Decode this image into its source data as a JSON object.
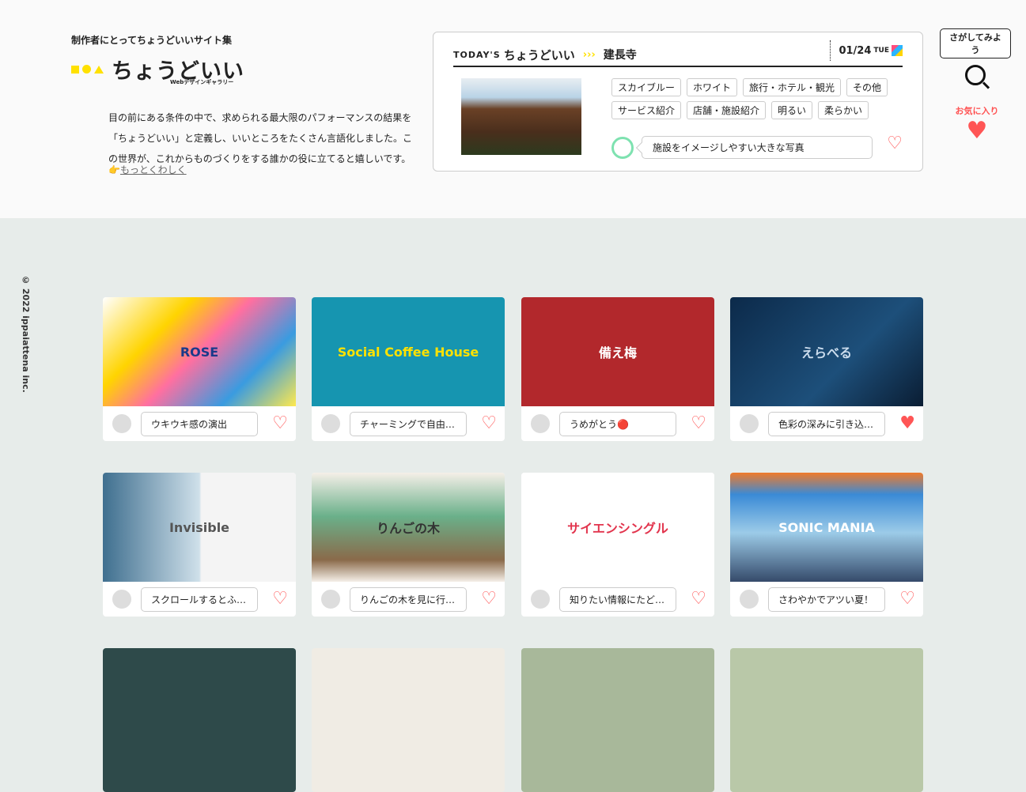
{
  "header": {
    "tagline": "制作者にとってちょうどいいサイト集",
    "logo": "ちょうどいい",
    "logo_sub": "Webデザインギャラリー",
    "description": "目の前にある条件の中で、求められる最大限のパフォーマンスの結果を「ちょうどいい」と定義し、いいところをたくさん言語化しました。この世界が、これからものづくりをする誰かの役に立てると嬉しいです。",
    "more_link": "もっとくわしく"
  },
  "today": {
    "label": "TODAY'S",
    "title": "ちょうどいい",
    "arrows": "›››",
    "site": "建長寺",
    "date": "01/24",
    "weekday": "TUE",
    "tags": [
      "スカイブルー",
      "ホワイト",
      "旅行・ホテル・観光",
      "その他",
      "サービス紹介",
      "店舗・施設紹介",
      "明るい",
      "柔らかい"
    ],
    "comment": "施設をイメージしやすい大きな写真"
  },
  "nav": {
    "search_tip": "さがしてみよう",
    "favorites": "お気に入り"
  },
  "copyright": "© 2022 ippaiattena inc.",
  "cards": [
    {
      "thumb_text": "ROSE",
      "comment": "ウキウキ感の演出",
      "favorited": false,
      "bg": "linear-gradient(135deg,#fff 0,#ffd400 30%,#ff6fa0 50%,#3a9be0 75%,#ffe94d 100%)",
      "fg": "#1a3a8a"
    },
    {
      "thumb_text": "Social Coffee House",
      "comment": "チャーミングで自由な雰囲気",
      "favorited": false,
      "bg": "#1695b0",
      "fg": "#ffe100"
    },
    {
      "thumb_text": "備え梅",
      "comment": "うめがとう🔴",
      "favorited": false,
      "bg": "#b2282c",
      "fg": "#fff"
    },
    {
      "thumb_text": "えらべる",
      "comment": "色彩の深みに引き込まれる",
      "favorited": true,
      "bg": "linear-gradient(135deg,#0c2a4a,#1d4f7a 60%,#0a1d33)",
      "fg": "#cde"
    },
    {
      "thumb_text": "Invisible",
      "comment": "スクロールするとふわっと",
      "favorited": false,
      "bg": "linear-gradient(90deg,#3f6f8f 0,#cfe0ea 50%,#f4f4f4 51%)",
      "fg": "#555"
    },
    {
      "thumb_text": "りんごの木",
      "comment": "りんごの木を見に行きたくなる",
      "favorited": false,
      "bg": "linear-gradient(180deg,#f5efe8,#6ab08a 40%,#8a6a4a 80%,#f5efe8)",
      "fg": "#333"
    },
    {
      "thumb_text": "サイエンシングル",
      "comment": "知りたい情報にたどり着ける",
      "favorited": false,
      "bg": "#fff",
      "fg": "#e2344d"
    },
    {
      "thumb_text": "SONIC MANIA",
      "comment": "さわやかでアツい夏！",
      "favorited": false,
      "bg": "linear-gradient(180deg,#f07a2a 0,#3a8ad6 20%,#9ccbe8 55%,#354a6a 100%)",
      "fg": "#fff"
    }
  ]
}
